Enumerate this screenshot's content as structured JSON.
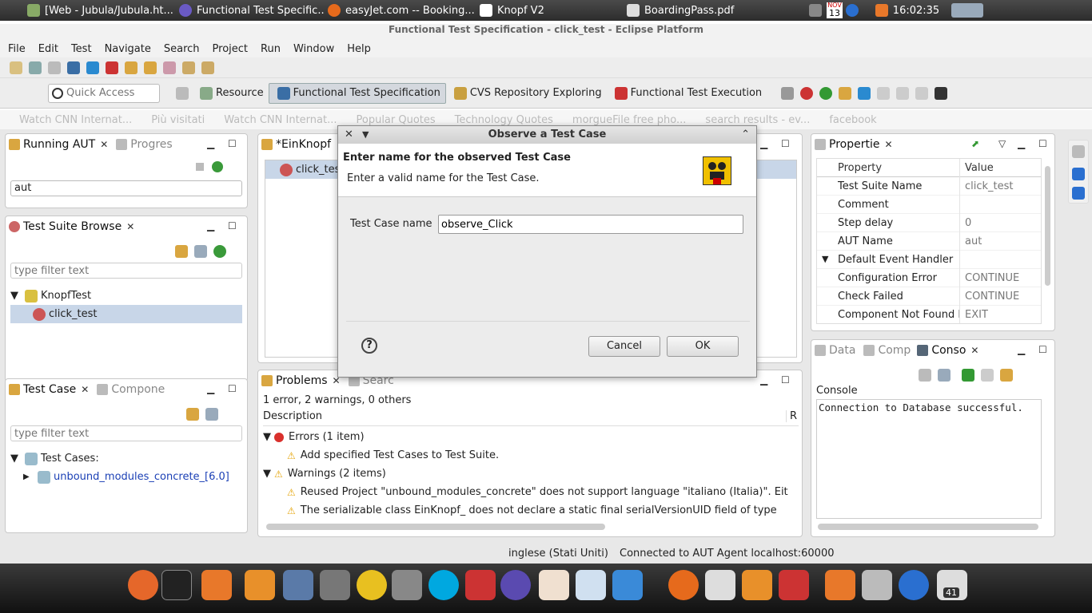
{
  "taskbar": {
    "tasks": [
      {
        "label": "[Web - Jubula/Jubula.ht..."
      },
      {
        "label": "Functional Test Specific..."
      },
      {
        "label": "easyJet.com -- Booking..."
      },
      {
        "label": "Knopf V2"
      },
      {
        "label": "BoardingPass.pdf"
      }
    ],
    "calendar_month": "NOV",
    "calendar_day": "13",
    "clock": "16:02:35"
  },
  "window": {
    "title": "Functional Test Specification - click_test - Eclipse Platform"
  },
  "menu": [
    "File",
    "Edit",
    "Test",
    "Navigate",
    "Search",
    "Project",
    "Run",
    "Window",
    "Help"
  ],
  "toolbar": {
    "quick_access_placeholder": "Quick Access",
    "perspectives": [
      "Resource",
      "Functional Test Specification",
      "CVS Repository Exploring",
      "Functional Test Execution"
    ]
  },
  "bookmarks": [
    "Watch CNN Internat...",
    "Più visitati",
    "Watch CNN Internat...",
    "Popular Quotes",
    "Technology Quotes",
    "morgueFile free pho...",
    "search results - ev...",
    "facebook"
  ],
  "running_aut": {
    "tab": "Running AUT",
    "tab2": "Progres",
    "item": "aut"
  },
  "test_suite_browser": {
    "tab": "Test Suite Browse",
    "filter_placeholder": "type filter text",
    "project": "KnopfTest",
    "suite": "click_test"
  },
  "test_case": {
    "tab": "Test Case",
    "tab2": "Compone",
    "filter_placeholder": "type filter text",
    "category": "Test Cases:",
    "item": "unbound_modules_concrete_[6.0]"
  },
  "editor": {
    "tab": "*EinKnopf",
    "item": "click_tes"
  },
  "problems": {
    "tab": "Problems",
    "tab2": "Searc",
    "summary": "1 error, 2 warnings, 0 others",
    "col_description": "Description",
    "col_r": "R",
    "errors_label": "Errors (1 item)",
    "error_1": "Add specified Test Cases to Test Suite.",
    "warnings_label": "Warnings (2 items)",
    "warning_1": "Reused Project \"unbound_modules_concrete\" does not support language \"italiano (Italia)\". Eit",
    "warning_2": "The serializable class EinKnopf_ does not declare a static final serialVersionUID field of type"
  },
  "properties": {
    "tab": "Propertie",
    "col_property": "Property",
    "col_value": "Value",
    "rows": [
      {
        "name": "Test Suite Name",
        "value": "click_test"
      },
      {
        "name": "Comment",
        "value": ""
      },
      {
        "name": "Step delay",
        "value": "0"
      },
      {
        "name": "AUT Name",
        "value": "aut"
      },
      {
        "name": "Default Event Handler",
        "value": ""
      },
      {
        "name": "Configuration Error",
        "value": "CONTINUE"
      },
      {
        "name": "Check Failed",
        "value": "CONTINUE"
      },
      {
        "name": "Component Not Found Err",
        "value": "EXIT"
      }
    ]
  },
  "console": {
    "tab_data": "Data",
    "tab_comp": "Comp",
    "tab": "Conso",
    "label": "Console",
    "text": "Connection to Database successful."
  },
  "status": {
    "locale": "inglese (Stati Uniti)",
    "connection": "Connected to AUT Agent localhost:60000"
  },
  "dialog": {
    "title": "Observe a Test Case",
    "heading": "Enter name for the observed Test Case",
    "message": "Enter a valid name for the Test Case.",
    "field_label": "Test Case name",
    "field_value": "observe_Click",
    "cancel": "Cancel",
    "ok": "OK",
    "help": "?"
  },
  "dock": {
    "badge": "41"
  },
  "colors": {
    "accent": "#d4d8de",
    "selection": "#c8d6e8",
    "error": "#d9302c",
    "warning": "#e5a50a"
  }
}
